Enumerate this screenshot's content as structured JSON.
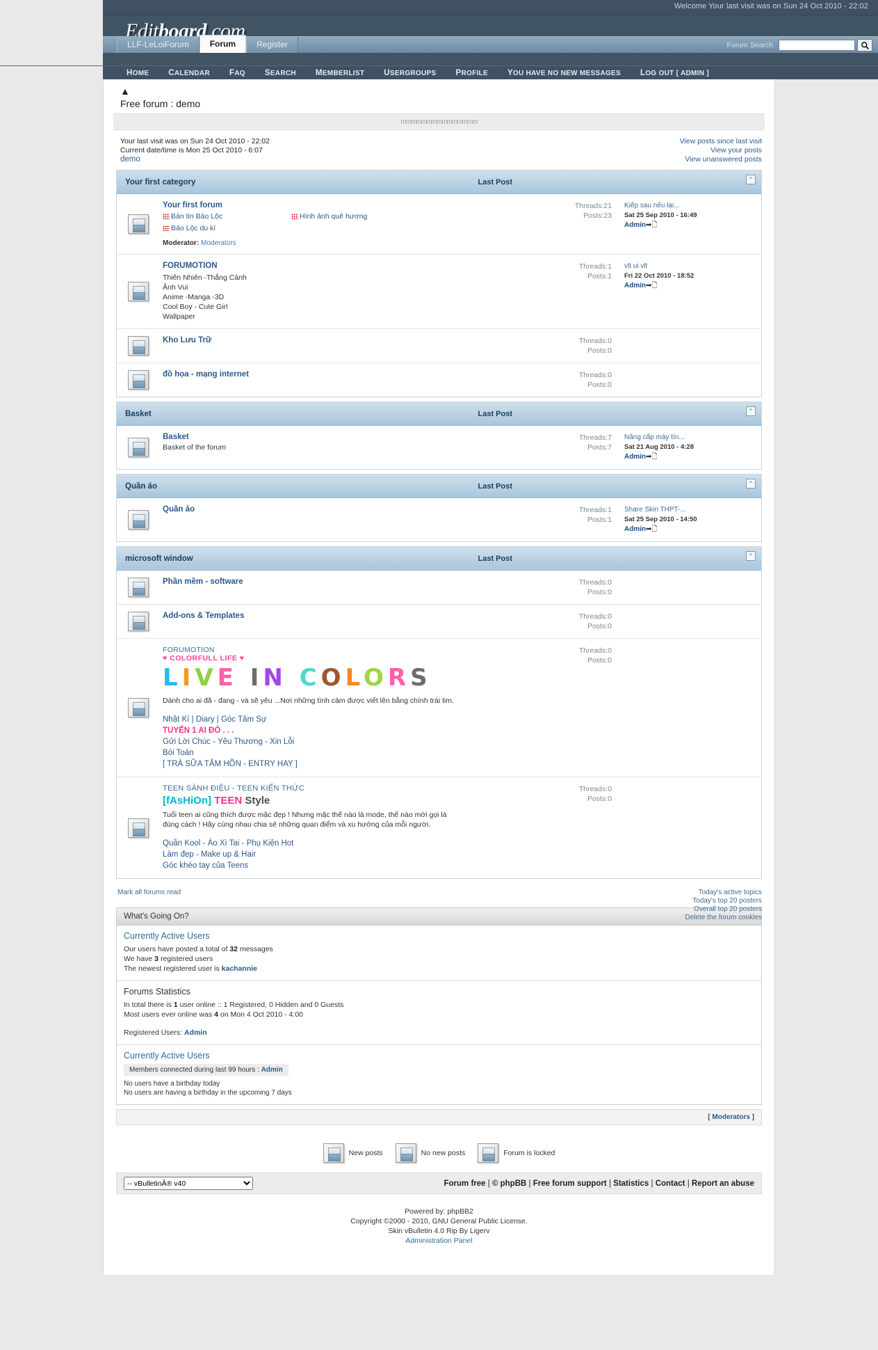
{
  "header": {
    "welcome": "Welcome Your last visit was on Sun 24 Oct 2010 - 22:02",
    "logo_part1": "Edit",
    "logo_part2": "board",
    "logo_part3": ".com",
    "tabs": [
      {
        "label": "LLF-LeLoiForum",
        "active": false
      },
      {
        "label": "Forum",
        "active": true
      },
      {
        "label": "Register",
        "active": false
      }
    ],
    "search_label": "Forum Search",
    "search_value": "",
    "search_placeholder": "",
    "search_icon": "search-icon",
    "nav": [
      "Home",
      "Calendar",
      "FAQ",
      "Search",
      "Memberlist",
      "Usergroups",
      "Profile",
      "You have no new messages",
      "Log out [ Admin ]"
    ]
  },
  "page": {
    "home_icon": "home-icon",
    "title": "Free forum : demo",
    "banner_text": "mmmmmmmmmmmmmmm",
    "last_visit": "Your last visit was on Sun 24 Oct 2010 - 22:02",
    "current_time": "Current date/time is Mon 25 Oct 2010 - 6:07",
    "demo_link": "demo",
    "right_links": [
      "View posts since last visit",
      "View your posts",
      "View unanswered posts"
    ]
  },
  "categories": [
    {
      "title": "Your first category",
      "last_post_header": "Last Post",
      "collapse_icon": "collapse-icon",
      "forums": [
        {
          "icon": "forum-folder-icon",
          "name": "Your first forum",
          "subforums": [
            "Bản tin Bảo Lộc",
            "Hình ảnh quê hương",
            "Bảo Lộc du kí"
          ],
          "moderator_label": "Moderator:",
          "moderator": "Moderators",
          "threads": "Threads:21",
          "posts": "Posts:23",
          "last_title": "Kiếp sau nếu lại...",
          "last_date": "Sat 25 Sep 2010 - 16:49",
          "last_user": "Admin"
        },
        {
          "icon": "forum-folder-icon",
          "name": "FORUMOTION",
          "lines": [
            "Thiên Nhiên -Thắng Cảnh",
            "Ảnh Vui",
            "Anime -Manga -3D",
            "Cool Boy - Cute Girl",
            "Wallpaper"
          ],
          "threads": "Threads:1",
          "posts": "Posts:1",
          "last_title": "vlt ui vlt",
          "last_date": "Fri 22 Oct 2010 - 18:52",
          "last_user": "Admin"
        },
        {
          "icon": "forum-folder-icon",
          "name": "Kho Lưu Trữ",
          "threads": "Threads:0",
          "posts": "Posts:0"
        },
        {
          "icon": "forum-folder-icon",
          "name": "đồ họa - mạng internet",
          "threads": "Threads:0",
          "posts": "Posts:0"
        }
      ]
    },
    {
      "title": "Basket",
      "last_post_header": "Last Post",
      "collapse_icon": "collapse-icon",
      "forums": [
        {
          "icon": "forum-folder-icon",
          "name": "Basket",
          "description": "Basket of the forum",
          "threads": "Threads:7",
          "posts": "Posts:7",
          "last_title": "Nâng cấp máy tín...",
          "last_date": "Sat 21 Aug 2010 - 4:28",
          "last_user": "Admin"
        }
      ]
    },
    {
      "title": "Quần áo",
      "last_post_header": "Last Post",
      "collapse_icon": "collapse-icon",
      "forums": [
        {
          "icon": "forum-folder-icon",
          "name": "Quần áo",
          "threads": "Threads:1",
          "posts": "Posts:1",
          "last_title": "Share Skin THPT-...",
          "last_date": "Sat 25 Sep 2010 - 14:50",
          "last_user": "Admin"
        }
      ]
    },
    {
      "title": "microsoft window",
      "last_post_header": "Last Post",
      "collapse_icon": "collapse-icon",
      "forums": [
        {
          "icon": "forum-folder-icon",
          "name": "Phần mềm - software",
          "threads": "Threads:0",
          "posts": "Posts:0"
        },
        {
          "icon": "forum-folder-icon",
          "name": "Add-ons & Templates",
          "threads": "Threads:0",
          "posts": "Posts:0"
        }
      ]
    }
  ],
  "color_block": {
    "icon": "forum-folder-icon",
    "eyebrow": "FORUMOTION",
    "tagline": "♥ COLORFULL LIFE ♥",
    "big_letters": [
      {
        "ch": "L",
        "color": "#22bbee"
      },
      {
        "ch": "I",
        "color": "#f59a1e"
      },
      {
        "ch": "V",
        "color": "#8fd13f"
      },
      {
        "ch": "E",
        "color": "#ff5fa8"
      },
      {
        "ch": " ",
        "color": "#ffffff"
      },
      {
        "ch": "I",
        "color": "#6d6d6d"
      },
      {
        "ch": "N",
        "color": "#a347e8"
      },
      {
        "ch": " ",
        "color": "#ffffff"
      },
      {
        "ch": "C",
        "color": "#4ed8d0"
      },
      {
        "ch": "O",
        "color": "#9c5a2c"
      },
      {
        "ch": "L",
        "color": "#f58a1e"
      },
      {
        "ch": "O",
        "color": "#9fd642"
      },
      {
        "ch": "R",
        "color": "#ff5fa8"
      },
      {
        "ch": "S",
        "color": "#6d6d6d"
      }
    ],
    "description": "Dành cho ai đã - đang - và sẽ yêu ...Nơi những tình cảm được viết lên bằng chính trái tim.",
    "links": [
      {
        "text": "Nhật Kí | Diary | Góc Tâm Sự",
        "hot": false
      },
      {
        "text": "TUYỂN 1 AI ĐÓ . . .",
        "hot": true
      },
      {
        "text": "Gửi Lời Chúc - Yêu Thương - Xin Lỗi",
        "hot": false
      },
      {
        "text": "Bói Toán",
        "hot": false
      },
      {
        "text": "[ TRÀ SỮA TÂM HỒN - ENTRY HAY ]",
        "hot": false
      }
    ],
    "threads": "Threads:0",
    "posts": "Posts:0"
  },
  "teen_block": {
    "icon": "forum-folder-icon",
    "eyebrow": "TEEN SÀNH ĐIỆU - TEEN KIẾN THỨC",
    "title_part1": "[fAsHiOn]",
    "title_part2": "TEEN",
    "title_part3": "Style",
    "description": "Tuổi teen ai cũng thích được mặc đẹp ! Nhưng mặc thế nào là mode, thế nào mới gọi là đúng cách ! Hãy cùng nhau chia sẻ những quan điểm và xu hướng của mỗi người.",
    "links": [
      "Quần Kool - Áo Xì Tai - Phụ Kiện Hot",
      "Làm đẹp - Make up & Hair",
      "Góc khéo tay của Teens"
    ],
    "threads": "Threads:0",
    "posts": "Posts:0"
  },
  "mark_row": {
    "mark_all": "Mark all forums read",
    "links": [
      "Today's active topics",
      "Today's top 20 posters",
      "Overall top 20 posters",
      "Delete the forum cookies"
    ]
  },
  "whats_going_on": {
    "head": "What's Going On?",
    "active_users_title": "Currently Active Users",
    "total_prefix": "Our users have posted a total of",
    "total_count": "32",
    "total_suffix": "messages",
    "registered_prefix": "We have",
    "registered_count": "3",
    "registered_suffix": "registered users",
    "newest_prefix": "The newest registered user is",
    "newest_user": "kachannie",
    "stats_title": "Forums Statistics",
    "online_prefix": "In total there is",
    "online_count": "1",
    "online_suffix": "user online :: 1 Registered, 0 Hidden and 0 Guests",
    "most_prefix": "Most users ever online was",
    "most_count": "4",
    "most_suffix": "on Mon 4 Oct 2010 - 4:00",
    "reg_users_label": "Registered Users:",
    "reg_users_value": "Admin",
    "active2_title": "Currently Active Users",
    "connected_text": "Members connected during last 99 hours :",
    "connected_user": "Admin",
    "birthday_today": "No users have a birthday today",
    "birthday_upcoming": "No users are having a birthday in the upcoming 7 days",
    "moderators_link": "[ Moderators ]"
  },
  "legend": [
    {
      "icon": "new-posts-icon",
      "label": "New posts"
    },
    {
      "icon": "no-new-posts-icon",
      "label": "No new posts"
    },
    {
      "icon": "forum-locked-icon",
      "label": "Forum is locked"
    }
  ],
  "footer": {
    "select_value": "-- vBulletinÂ® v40",
    "select_options": [
      "-- vBulletinÂ® v40"
    ],
    "links": [
      "Forum free",
      "© phpBB",
      "Free forum support",
      "Statistics",
      "Contact",
      "Report an abuse"
    ],
    "powered": "Powered by: phpBB2",
    "copyright": "Copyright ©2000 - 2010, GNU General Public License.",
    "skin": "Skin vBulletin 4.0 Rip By Ligerv",
    "admin_panel": "Administration Panel"
  }
}
